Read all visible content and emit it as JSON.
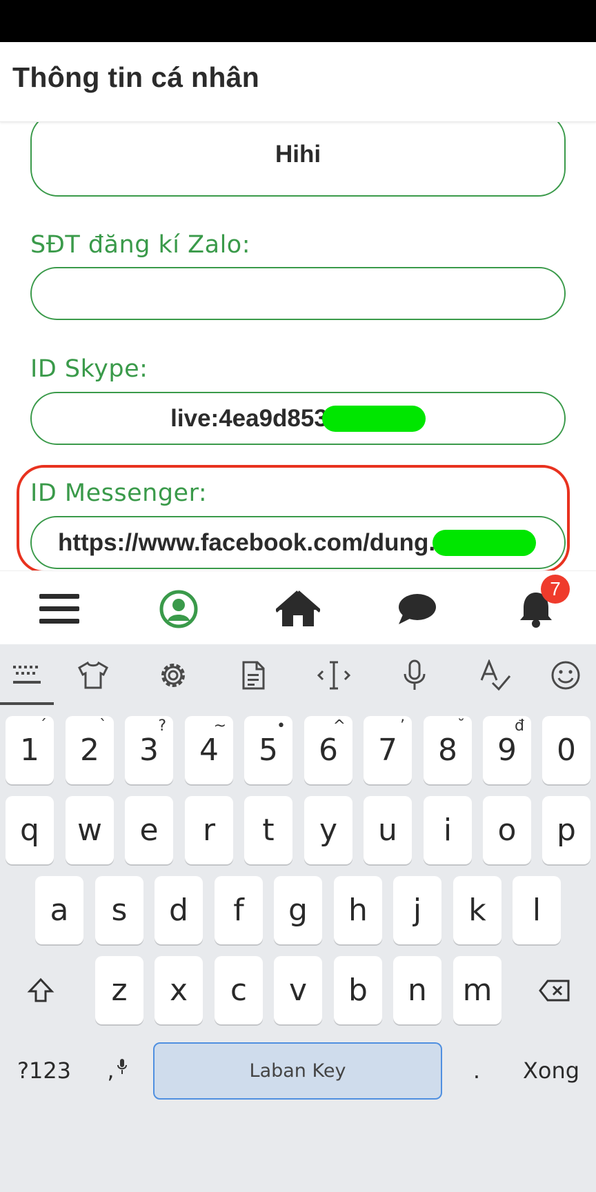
{
  "header": {
    "title": "Thông tin cá nhân"
  },
  "form": {
    "name_value": "Hihi",
    "zalo_label": "SĐT đăng kí Zalo:",
    "zalo_value": "",
    "skype_label": "ID Skype:",
    "skype_value": "live:4ea9d853",
    "messenger_label": "ID Messenger:",
    "messenger_value": "https://www.facebook.com/dung."
  },
  "bottom_nav": {
    "items": [
      "menu-icon",
      "profile-icon",
      "home-icon",
      "chat-icon",
      "bell-icon"
    ],
    "notification_count": "7",
    "active_color": "#3a9a4a"
  },
  "keyboard": {
    "toolbar": [
      "keyboard-icon",
      "theme-icon",
      "settings-icon",
      "clipboard-icon",
      "cursor-icon",
      "mic-icon",
      "spellcheck-icon",
      "emoji-icon"
    ],
    "number_row": [
      {
        "key": "1",
        "hint": "´"
      },
      {
        "key": "2",
        "hint": "`"
      },
      {
        "key": "3",
        "hint": "?"
      },
      {
        "key": "4",
        "hint": "~"
      },
      {
        "key": "5",
        "hint": "•"
      },
      {
        "key": "6",
        "hint": "^"
      },
      {
        "key": "7",
        "hint": "’"
      },
      {
        "key": "8",
        "hint": "˘"
      },
      {
        "key": "9",
        "hint": "đ"
      },
      {
        "key": "0",
        "hint": ""
      }
    ],
    "row1": [
      "q",
      "w",
      "e",
      "r",
      "t",
      "y",
      "u",
      "i",
      "o",
      "p"
    ],
    "row2": [
      "a",
      "s",
      "d",
      "f",
      "g",
      "h",
      "j",
      "k",
      "l"
    ],
    "row3": [
      "z",
      "x",
      "c",
      "v",
      "b",
      "n",
      "m"
    ],
    "symbols_label": "?123",
    "comma_label": ",",
    "space_label": "Laban Key",
    "period_label": ".",
    "done_label": "Xong"
  }
}
